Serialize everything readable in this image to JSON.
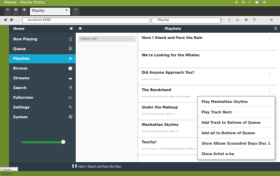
{
  "browser": {
    "window_title": "Mopidy - Mozilla Firefox",
    "tab_label": "Mopidy",
    "url": "localhost:6680",
    "search_value": "Mopidy"
  },
  "sidebar": {
    "header": "Home",
    "items": [
      {
        "label": "Now Playing"
      },
      {
        "label": "Queue"
      },
      {
        "label": "Playlists"
      },
      {
        "label": "Browse"
      },
      {
        "label": "Streams"
      },
      {
        "label": "Search"
      },
      {
        "label": "Fullscreen"
      },
      {
        "label": "Settings"
      },
      {
        "label": "System"
      }
    ],
    "volume": 0.92
  },
  "main": {
    "header": "Playlists",
    "playlist_item": "Classic rock",
    "tracks": [
      {
        "title": "Here I Stand and Face the Rain",
        "sub": ""
      },
      {
        "title": "We're Looking for the Whales",
        "sub": ""
      },
      {
        "title": "Did Anyone Approach You?",
        "sub": "a-ha / Lifelines"
      },
      {
        "title": "The Bandstand",
        "sub": "a-ha / East of the Sun, West of the Moon"
      },
      {
        "title": "Under the Makeup",
        "sub": "a-ha / Cast in Steel (Disc 1)"
      },
      {
        "title": "Manhattan Skyline",
        "sub": "a-ha / Scoundrel Days (Disc 1)"
      },
      {
        "title": "Touchy!",
        "sub": "a-ha / Stay on These Roads (Deluxe Edition)"
      }
    ]
  },
  "context_menu": [
    {
      "label": "Play Manhattan Skyline"
    },
    {
      "label": "Play Track Next"
    },
    {
      "label": "Add Track to Bottom of Queue"
    },
    {
      "label": "Add all to Bottom of Queue"
    },
    {
      "label": "Show Album Scoundrel Days Disc 1"
    },
    {
      "label": "Show Artist a-ha"
    }
  ],
  "footer": {
    "now_playing": "Here I Stand and Face the Rain"
  },
  "taskbar": {
    "chip": "mopidy - browser"
  }
}
